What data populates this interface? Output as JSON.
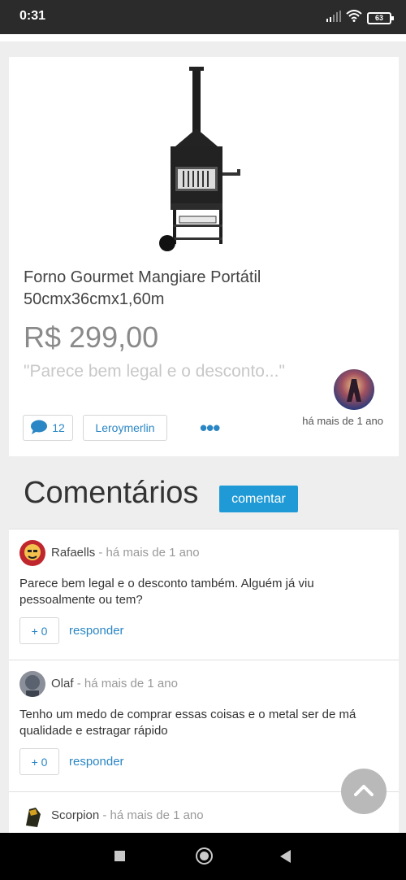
{
  "status_bar": {
    "time": "0:31",
    "battery": "63"
  },
  "product": {
    "title": "Forno Gourmet Mangiare Portátil 50cmx36cmx1,60m",
    "price": "R$ 299,00",
    "quote": "\"Parece bem legal e o desconto...\"",
    "posted": "há mais de 1 ano",
    "comment_count": "12",
    "store": "Leroymerlin",
    "more": "•••"
  },
  "comments_section": {
    "heading": "Comentários",
    "comment_button": "comentar"
  },
  "comments": [
    {
      "author": "Rafaells",
      "time": "- há mais de 1 ano",
      "text": "Parece bem legal e o desconto também. Alguém já viu pessoalmente ou tem?",
      "votes": "+ 0",
      "reply": "responder"
    },
    {
      "author": "Olaf",
      "time": "- há mais de 1 ano",
      "text": "Tenho um medo de comprar essas coisas e o metal ser de má qualidade e estragar rápido",
      "votes": "+ 0",
      "reply": "responder"
    },
    {
      "author": "Scorpion",
      "time": "- há mais de 1 ano"
    }
  ],
  "icons": {
    "wifi": "wifi-icon",
    "signal": "signal-icon",
    "battery": "battery-icon",
    "comment": "speech-bubble-icon",
    "scroll_top": "chevron-up-icon",
    "nav": [
      "square-icon",
      "circle-icon",
      "back-triangle-icon"
    ]
  },
  "colors": {
    "accent": "#1f9ad6",
    "link": "#2a86c4",
    "status_bar": "#2b2b2b"
  }
}
